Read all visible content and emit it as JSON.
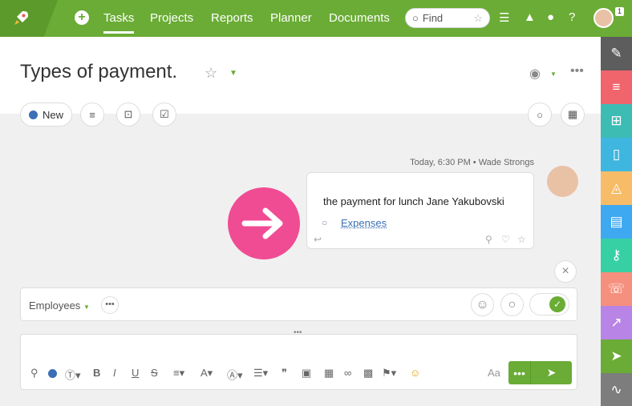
{
  "topbar": {
    "nav": [
      "Tasks",
      "Projects",
      "Reports",
      "Planner",
      "Documents"
    ],
    "search_placeholder": "Find",
    "badge_count": "1"
  },
  "task": {
    "title": "Types of payment.",
    "status_label": "New"
  },
  "message": {
    "meta": "Today, 6:30 PM • Wade Strongs",
    "text": "the payment for lunch Jane Yakubovski",
    "tag": "Expenses"
  },
  "composer": {
    "employees_label": "Employees",
    "font_size_label": "Aa",
    "more_label": "•••"
  },
  "colors": {
    "brand": "#6aac35",
    "accent_arrow": "#f04c94",
    "sidebar": [
      "#5d5d5d",
      "#f0646c",
      "#3dbcb4",
      "#3fb6df",
      "#f7bc67",
      "#3ea9f0",
      "#37d0a4",
      "#f5907e",
      "#b884e5",
      "#6aac35",
      "#7d7d7d"
    ]
  },
  "sidebar_icons": [
    "edit-icon",
    "list-icon",
    "structure-icon",
    "documents-icon",
    "bell-icon",
    "clipboard-icon",
    "key-icon",
    "phone-icon",
    "chart-icon",
    "send-icon",
    "pulse-icon"
  ]
}
